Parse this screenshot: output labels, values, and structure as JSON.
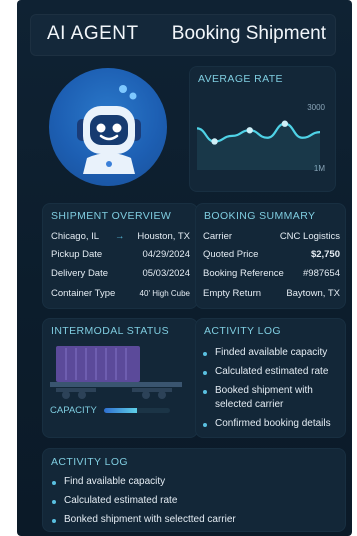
{
  "header": {
    "app_title": "AI AGENT",
    "page_title": "Booking Shipment"
  },
  "average_rate": {
    "title": "AVERAGE RATE",
    "axis_max_label": "3000",
    "axis_min_label": "1M"
  },
  "chart_data": {
    "type": "line",
    "title": "AVERAGE RATE",
    "x": [
      1,
      2,
      3,
      4,
      5,
      6,
      7,
      8
    ],
    "values": [
      1800,
      1100,
      1400,
      1700,
      1300,
      2050,
      1300,
      1600
    ],
    "ylim": [
      0,
      3000
    ],
    "grid": false
  },
  "shipment_overview": {
    "title": "SHIPMENT OVERVIEW",
    "origin": "Chicago, IL",
    "arrow": "→",
    "destination": "Houston, TX",
    "rows": [
      {
        "key": "Pickup Date",
        "value": "04/29/2024"
      },
      {
        "key": "Delivery Date",
        "value": "05/03/2024"
      },
      {
        "key": "Container Type",
        "value": "40' High Cube"
      }
    ]
  },
  "booking_summary": {
    "title": "BOOKING SUMMARY",
    "rows": [
      {
        "key": "Carrier",
        "value": "CNC Logistics"
      },
      {
        "key": "Quoted Price",
        "value": "$2,750"
      },
      {
        "key": "Booking Reference",
        "value": "#987654"
      },
      {
        "key": "Empty Return",
        "value": "Baytown, TX"
      }
    ]
  },
  "intermodal_status": {
    "title": "INTERMODAL STATUS",
    "capacity_label": "CAPACITY",
    "capacity_fraction": 0.5,
    "colors": {
      "container": "#5b4a9a",
      "fill_a": "#2f6fd0",
      "fill_b": "#5fd0e8"
    }
  },
  "activity_log_right": {
    "title": "ACTIVITY LOG",
    "items": [
      "Finded available capacity",
      "Calculated estimated rate",
      "Booked shipment with",
      "selected carrier",
      "Confirmed booking details"
    ]
  },
  "activity_log_bottom": {
    "title": "ACTIVITY LOG",
    "items": [
      "Find available capacity",
      "Calculated estimated rate",
      "Bonked shipment with selectted carrier"
    ]
  },
  "colors": {
    "accent": "#59c0e0",
    "line": "#4fd2e6",
    "background": "#0f2233"
  }
}
